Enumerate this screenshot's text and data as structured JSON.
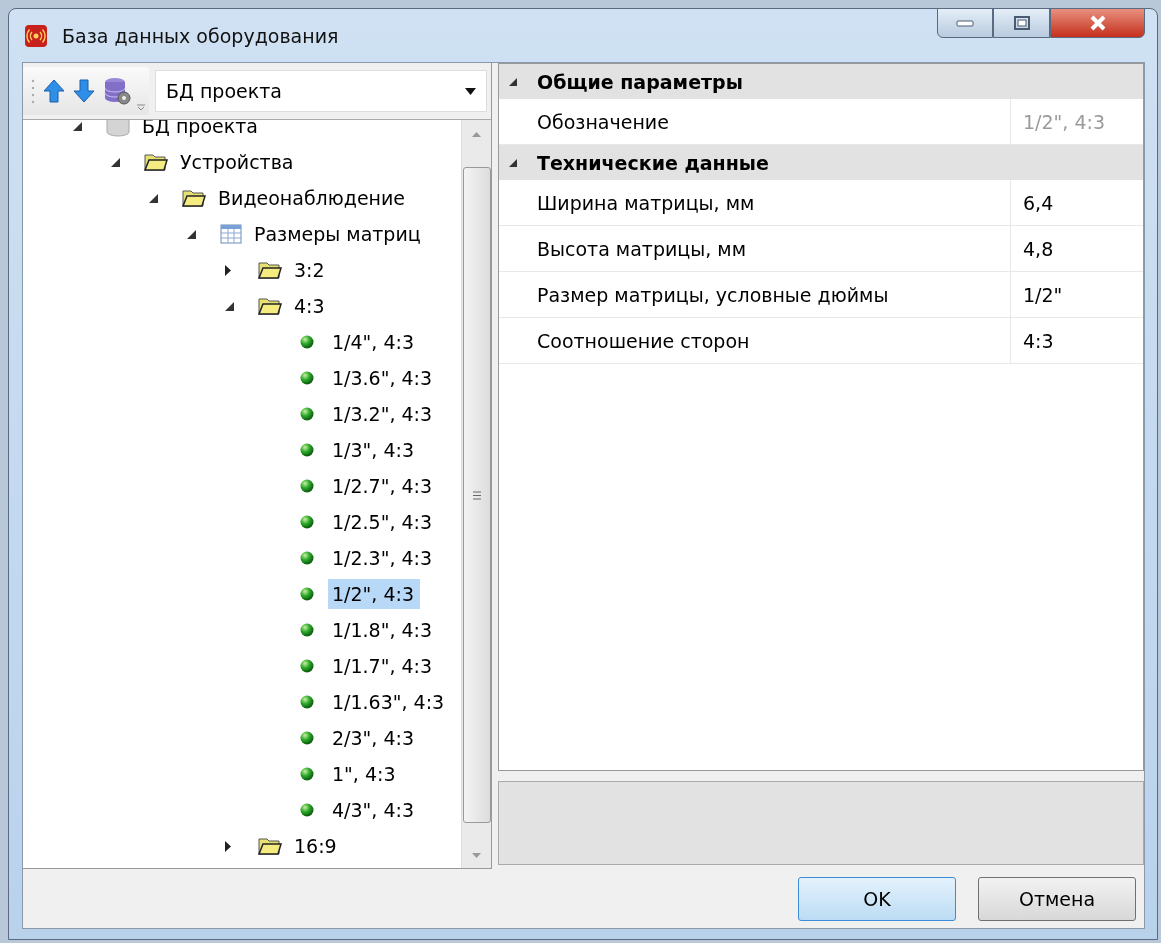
{
  "window": {
    "title": "База данных оборудования"
  },
  "toolbar": {
    "source_dropdown": {
      "value": "БД проекта"
    }
  },
  "tree": [
    {
      "label": "БД проекта",
      "kind": "database",
      "expanded": true,
      "selected": false,
      "children": [
        {
          "label": "Устройства",
          "kind": "folder",
          "expanded": true,
          "selected": false,
          "children": [
            {
              "label": "Видеонаблюдение",
              "kind": "folder",
              "expanded": true,
              "selected": false,
              "children": [
                {
                  "label": "Размеры матриц",
                  "kind": "table",
                  "expanded": true,
                  "selected": false,
                  "children": [
                    {
                      "label": "3:2",
                      "kind": "folder",
                      "expanded": false,
                      "selected": false
                    },
                    {
                      "label": "4:3",
                      "kind": "folder",
                      "expanded": true,
                      "selected": false,
                      "children": [
                        {
                          "label": "1/4\", 4:3",
                          "kind": "item",
                          "selected": false
                        },
                        {
                          "label": "1/3.6\", 4:3",
                          "kind": "item",
                          "selected": false
                        },
                        {
                          "label": "1/3.2\", 4:3",
                          "kind": "item",
                          "selected": false
                        },
                        {
                          "label": "1/3\", 4:3",
                          "kind": "item",
                          "selected": false
                        },
                        {
                          "label": "1/2.7\", 4:3",
                          "kind": "item",
                          "selected": false
                        },
                        {
                          "label": "1/2.5\", 4:3",
                          "kind": "item",
                          "selected": false
                        },
                        {
                          "label": "1/2.3\", 4:3",
                          "kind": "item",
                          "selected": false
                        },
                        {
                          "label": "1/2\", 4:3",
                          "kind": "item",
                          "selected": true
                        },
                        {
                          "label": "1/1.8\", 4:3",
                          "kind": "item",
                          "selected": false
                        },
                        {
                          "label": "1/1.7\", 4:3",
                          "kind": "item",
                          "selected": false
                        },
                        {
                          "label": "1/1.63\", 4:3",
                          "kind": "item",
                          "selected": false
                        },
                        {
                          "label": "2/3\", 4:3",
                          "kind": "item",
                          "selected": false
                        },
                        {
                          "label": "1\", 4:3",
                          "kind": "item",
                          "selected": false
                        },
                        {
                          "label": "4/3\", 4:3",
                          "kind": "item",
                          "selected": false
                        }
                      ]
                    },
                    {
                      "label": "16:9",
                      "kind": "folder",
                      "expanded": false,
                      "selected": false
                    }
                  ]
                }
              ]
            }
          ]
        }
      ]
    }
  ],
  "properties": [
    {
      "category": "Общие параметры",
      "expanded": true,
      "rows": [
        {
          "name": "Обозначение",
          "value": "1/2\", 4:3",
          "disabled": true
        }
      ]
    },
    {
      "category": "Технические данные",
      "expanded": true,
      "rows": [
        {
          "name": "Ширина матрицы, мм",
          "value": "6,4",
          "disabled": false
        },
        {
          "name": "Высота матрицы, мм",
          "value": "4,8",
          "disabled": false
        },
        {
          "name": "Размер матрицы, условные дюймы",
          "value": "1/2\"",
          "disabled": false
        },
        {
          "name": "Соотношение сторон",
          "value": "4:3",
          "disabled": false
        }
      ]
    }
  ],
  "buttons": [
    {
      "label": "OK",
      "default": true
    },
    {
      "label": "Отмена",
      "default": false
    }
  ]
}
